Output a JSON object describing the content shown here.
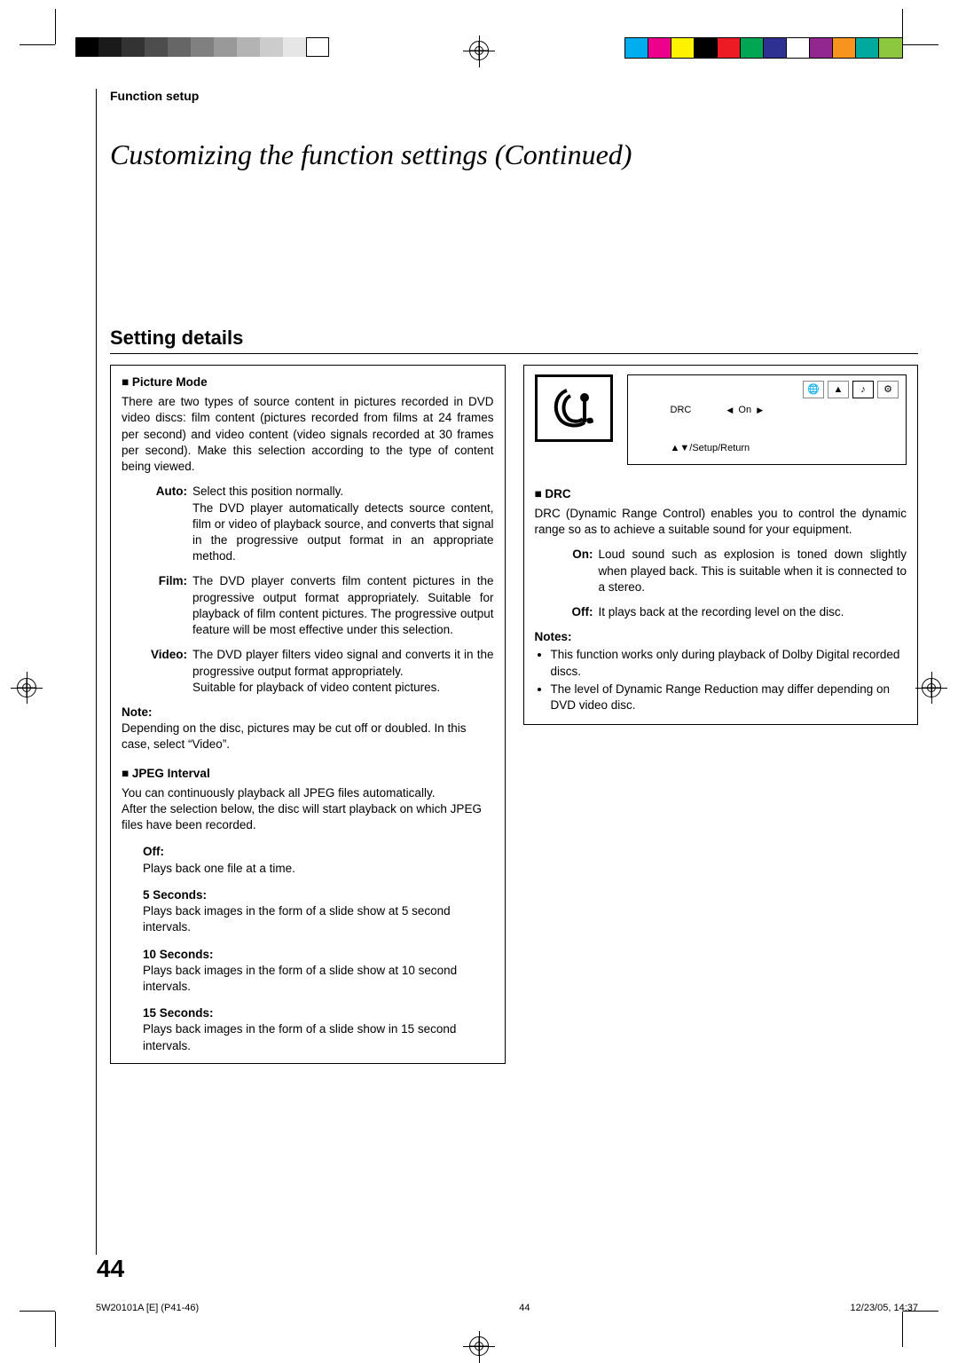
{
  "header": {
    "section": "Function setup",
    "title": "Customizing the function settings (Continued)"
  },
  "sub_header": "Setting details",
  "picture_mode": {
    "title": "Picture Mode",
    "intro": "There are two types of source content in pictures recorded in DVD video discs: film content (pictures recorded from films at 24 frames per second) and video content (video signals recorded at 30 frames per second). Make this selection according to the type of content being viewed.",
    "opts": {
      "auto_label": "Auto:",
      "auto_body": "Select this position normally.\nThe DVD player automatically detects source content, film or video of playback source, and converts that signal in the progressive output format in an appropriate method.",
      "film_label": "Film:",
      "film_body": "The DVD player converts film content pictures in the progressive output format appropriately. Suitable for playback of film content pictures. The progressive output feature will be most effective under this selection.",
      "video_label": "Video:",
      "video_body": "The DVD player filters video signal and converts it in the progressive output format appropriately.\nSuitable for playback of video content pictures."
    },
    "note_label": "Note:",
    "note_body": "Depending on the disc, pictures may be cut off or doubled. In this case, select “Video”."
  },
  "jpeg": {
    "title": "JPEG Interval",
    "intro": "You can continuously playback all JPEG files automatically.\nAfter the selection below, the disc will start playback on which JPEG files have been recorded.",
    "off_label": "Off:",
    "off_body": "Plays back one file at a time.",
    "s5_label": "5 Seconds:",
    "s5_body": "Plays back images in the form of a slide show at 5 second intervals.",
    "s10_label": "10 Seconds:",
    "s10_body": "Plays back images in the form of a slide show at 10 second intervals.",
    "s15_label": "15 Seconds:",
    "s15_body": "Plays back images in the form of a slide show in 15 second intervals."
  },
  "screen": {
    "drc_label": "DRC",
    "value": "On",
    "return": "▲▼/Setup/Return"
  },
  "drc": {
    "title": "DRC",
    "intro": "DRC (Dynamic Range Control) enables you to control the dynamic range so as to achieve a suitable sound for your equipment.",
    "on_label": "On:",
    "on_body": "Loud sound such as explosion is toned down slightly when played back. This is suitable when it is connected to a stereo.",
    "off_label": "Off:",
    "off_body": "It plays back at the recording level on the disc.",
    "notes_label": "Notes:",
    "note1": "This function works only during playback of Dolby Digital recorded discs.",
    "note2": "The level of Dynamic Range Reduction may differ depending on DVD video disc."
  },
  "page_number": "44",
  "footer": {
    "left": "5W20101A [E] (P41-46)",
    "mid": "44",
    "right": "12/23/05, 14:37"
  },
  "colors": {
    "bars": [
      "#00aeef",
      "#ec008c",
      "#fff200",
      "#000000",
      "#ed1c24",
      "#00a651",
      "#2e3192",
      "#ffffff",
      "#92278f",
      "#f7941d",
      "#00a99d",
      "#8dc63f"
    ]
  }
}
